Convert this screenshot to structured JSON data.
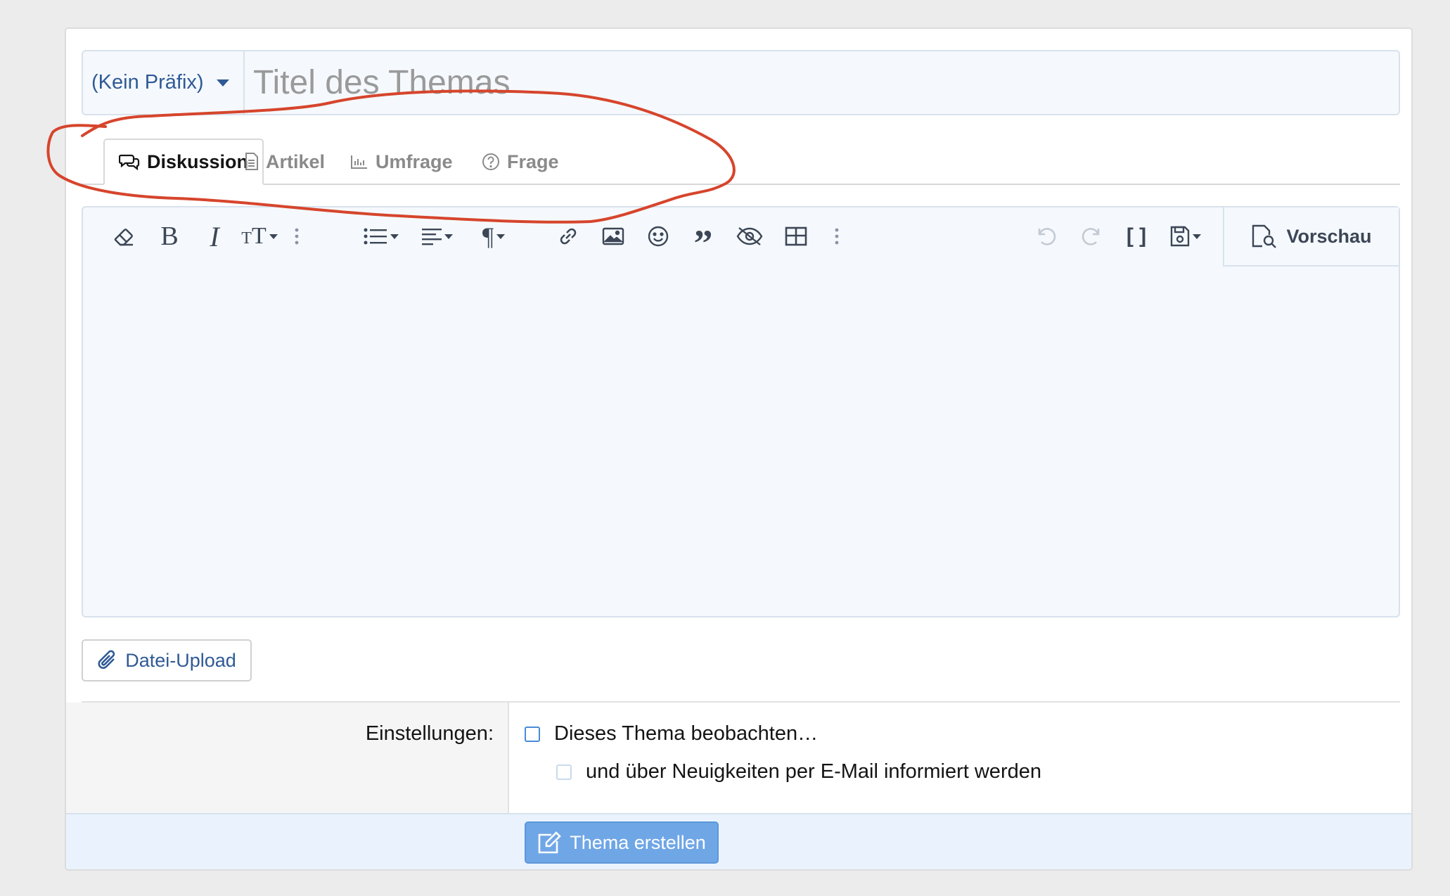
{
  "header": {
    "prefix_label": "(Kein Präfix)",
    "title_placeholder": "Titel des Themas",
    "title_value": ""
  },
  "tabs": [
    {
      "label": "Diskussion",
      "icon": "discussion-icon",
      "active": true
    },
    {
      "label": "Artikel",
      "icon": "article-icon",
      "active": false
    },
    {
      "label": "Umfrage",
      "icon": "poll-icon",
      "active": false
    },
    {
      "label": "Frage",
      "icon": "question-icon",
      "active": false
    }
  ],
  "toolbar": {
    "left_icons": [
      "eraser-icon",
      "bold-icon",
      "italic-icon",
      "text-size-icon",
      "more-vertical-icon",
      "list-icon",
      "align-icon",
      "paragraph-icon",
      "link-icon",
      "image-icon",
      "smiley-icon",
      "quote-icon",
      "hide-icon",
      "table-icon",
      "more-vertical-icon"
    ],
    "right_icons": [
      "undo-icon",
      "redo-icon",
      "brackets-icon",
      "save-draft-icon"
    ],
    "preview_label": "Vorschau"
  },
  "editor": {
    "content": ""
  },
  "upload": {
    "label": "Datei-Upload"
  },
  "settings": {
    "label": "Einstellungen:",
    "watch_label": "Dieses Thema beobachten…",
    "watch_checked": false,
    "email_label": "und über Neuigkeiten per E-Mail informiert werden",
    "email_checked": false
  },
  "submit": {
    "label": "Thema erstellen"
  },
  "colors": {
    "accent": "#2f5a95",
    "button": "#6fa6e6",
    "annotation": "#d6452c"
  }
}
